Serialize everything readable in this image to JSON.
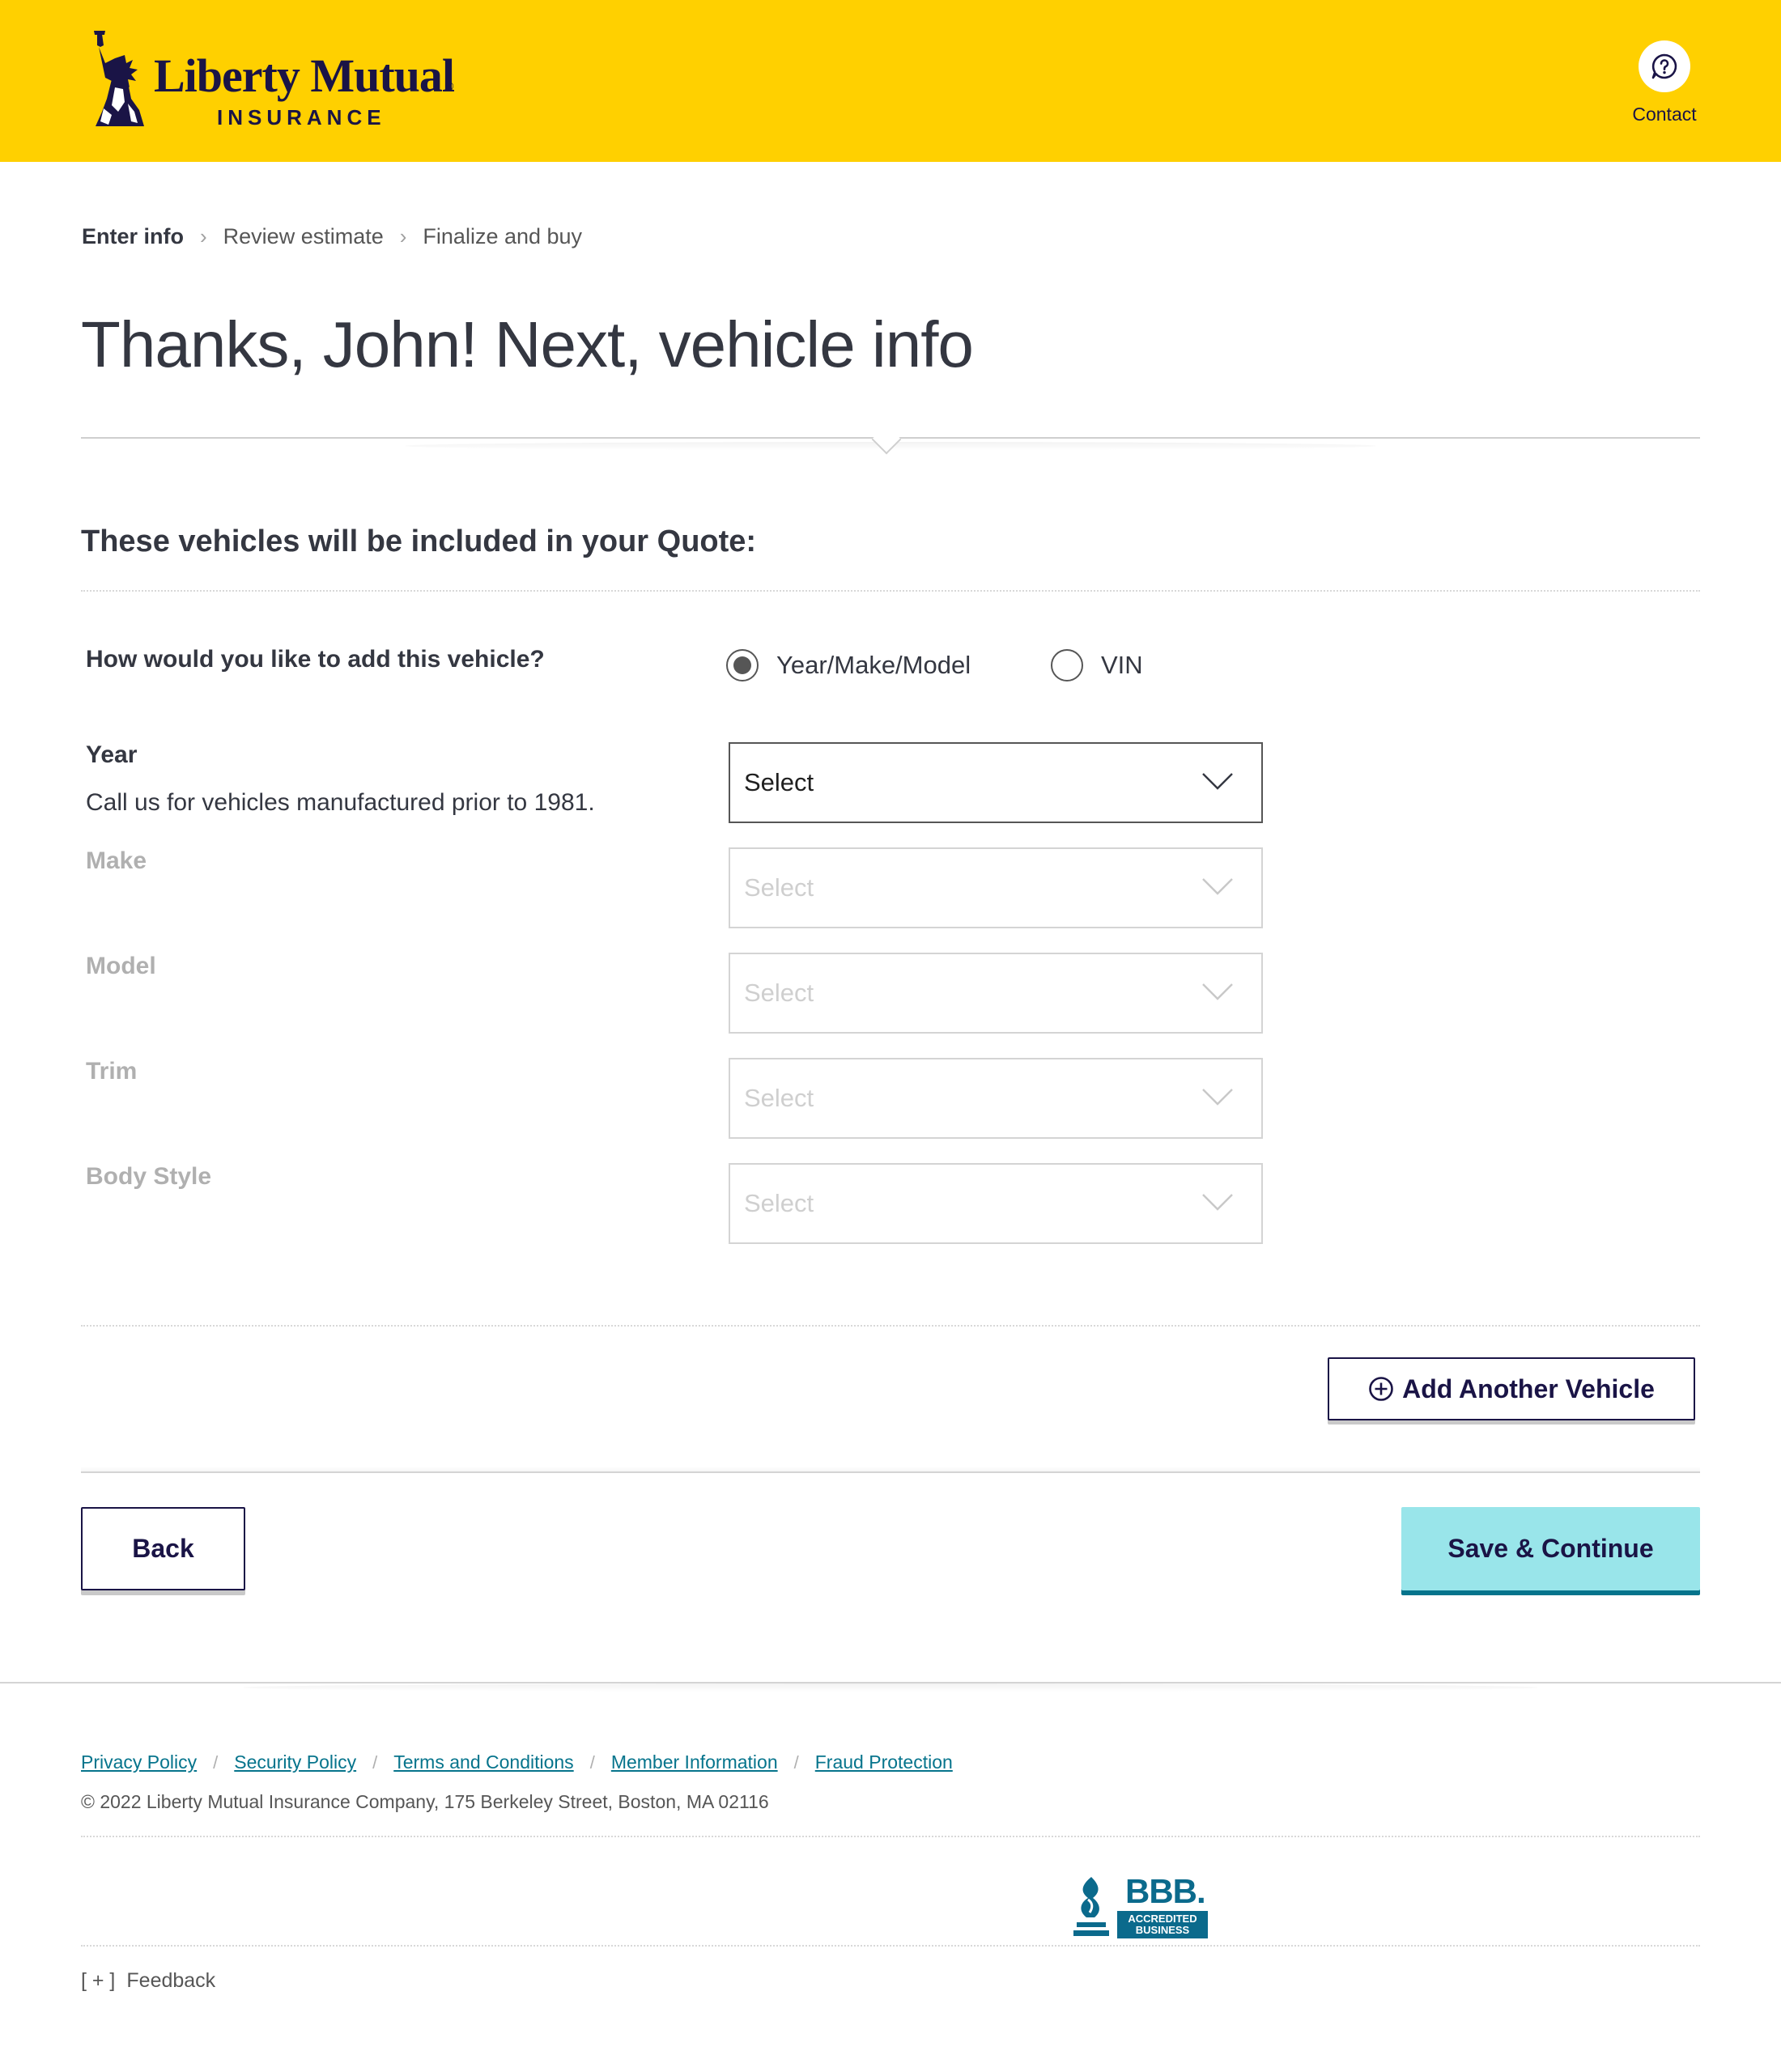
{
  "header": {
    "brand_name": "Liberty Mutual",
    "brand_sub": "INSURANCE",
    "brand_mark": "®",
    "contact_label": "Contact",
    "background_color": "#ffd000",
    "brand_color": "#1a1446"
  },
  "breadcrumb": {
    "items": [
      {
        "label": "Enter info",
        "active": true
      },
      {
        "label": "Review estimate",
        "active": false
      },
      {
        "label": "Finalize and buy",
        "active": false
      }
    ],
    "separator": "›"
  },
  "page": {
    "title": "Thanks, John! Next, vehicle info",
    "section_heading": "These vehicles will be included in your Quote:"
  },
  "vehicle_form": {
    "add_method_question": "How would you like to add this vehicle?",
    "add_method_options": [
      {
        "label": "Year/Make/Model",
        "selected": true
      },
      {
        "label": "VIN",
        "selected": false
      }
    ],
    "year": {
      "label": "Year",
      "hint": "Call us for vehicles manufactured prior to 1981.",
      "value": "Select",
      "enabled": true
    },
    "make": {
      "label": "Make",
      "value": "Select",
      "enabled": false
    },
    "model": {
      "label": "Model",
      "value": "Select",
      "enabled": false
    },
    "trim": {
      "label": "Trim",
      "value": "Select",
      "enabled": false
    },
    "body_style": {
      "label": "Body Style",
      "value": "Select",
      "enabled": false
    }
  },
  "actions": {
    "add_vehicle_label": "Add Another Vehicle",
    "back_label": "Back",
    "save_continue_label": "Save & Continue",
    "primary_color": "#99e5ea",
    "primary_shadow_color": "#06748c"
  },
  "footer": {
    "links": [
      "Privacy Policy",
      "Security Policy",
      "Terms and Conditions",
      "Member Information",
      "Fraud Protection"
    ],
    "link_separator": "/",
    "copyright": "© 2022 Liberty Mutual Insurance Company, 175 Berkeley Street, Boston, MA 02116",
    "bbb_logo_text": "BBB.",
    "bbb_badge_line1": "ACCREDITED",
    "bbb_badge_line2": "BUSINESS",
    "feedback_prefix": "[ + ]",
    "feedback_label": "Feedback",
    "link_color": "#06748c"
  }
}
